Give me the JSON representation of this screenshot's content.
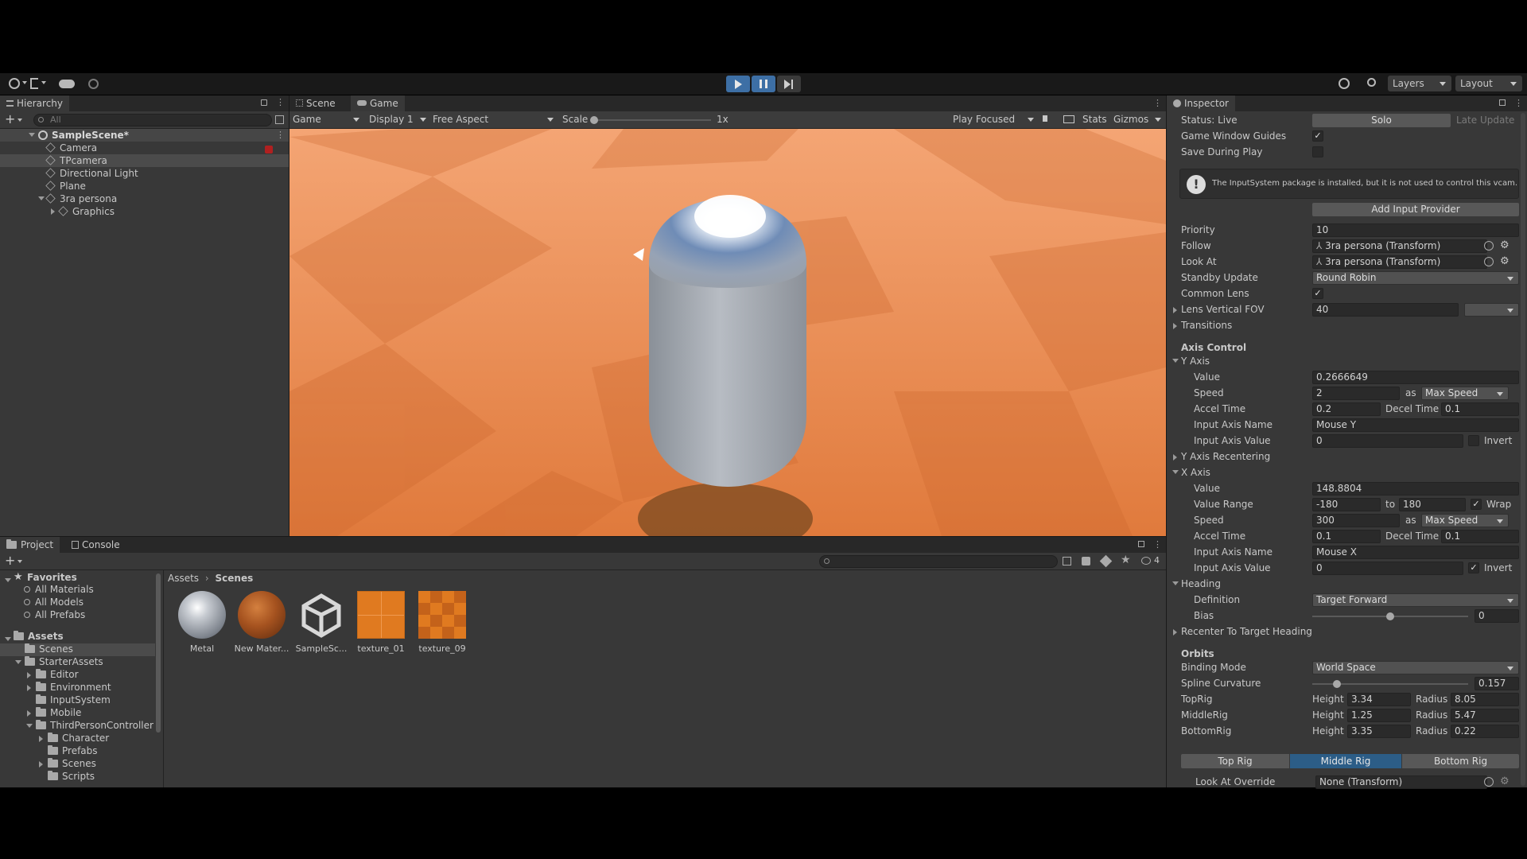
{
  "toolbar": {
    "layers": "Layers",
    "layout": "Layout"
  },
  "hierarchy": {
    "tab": "Hierarchy",
    "search_placeholder": "All",
    "scene": "SampleScene*",
    "items": [
      "Camera",
      "TPcamera",
      "Directional Light",
      "Plane",
      "3ra persona",
      "Graphics"
    ]
  },
  "viewport": {
    "tab_scene": "Scene",
    "tab_game": "Game",
    "game_dropdown": "Game",
    "display": "Display 1",
    "aspect": "Free Aspect",
    "scale_label": "Scale",
    "scale_value": "1x",
    "play_focused": "Play Focused",
    "stats": "Stats",
    "gizmos": "Gizmos"
  },
  "project": {
    "tab_project": "Project",
    "tab_console": "Console",
    "favorites": "Favorites",
    "fav_items": [
      "All Materials",
      "All Models",
      "All Prefabs"
    ],
    "assets": "Assets",
    "tree": [
      "Scenes",
      "StarterAssets",
      "Editor",
      "Environment",
      "InputSystem",
      "Mobile",
      "ThirdPersonController",
      "Character",
      "Prefabs",
      "Scenes",
      "Scripts"
    ],
    "breadcrumb": [
      "Assets",
      "Scenes"
    ],
    "hidden_count": "4",
    "asset_items": [
      "Metal",
      "New Mater...",
      "SampleSc...",
      "texture_01",
      "texture_09"
    ]
  },
  "inspector": {
    "tab": "Inspector",
    "status_label": "Status: Live",
    "solo": "Solo",
    "late_update": "Late Update",
    "game_window_guides": "Game Window Guides",
    "save_during_play": "Save During Play",
    "help_text": "The InputSystem package is installed, but it is not used to control this vcam.",
    "add_input_provider": "Add Input Provider",
    "priority": {
      "label": "Priority",
      "value": "10"
    },
    "follow": {
      "label": "Follow",
      "value": "3ra persona (Transform)"
    },
    "look_at": {
      "label": "Look At",
      "value": "3ra persona (Transform)"
    },
    "standby_update": {
      "label": "Standby Update",
      "value": "Round Robin"
    },
    "common_lens": "Common Lens",
    "lens_fov": {
      "label": "Lens Vertical FOV",
      "value": "40"
    },
    "transitions": "Transitions",
    "axis_control": "Axis Control",
    "y_axis": {
      "title": "Y Axis",
      "value_label": "Value",
      "value": "0.2666649",
      "speed_label": "Speed",
      "speed": "2",
      "as": "as",
      "speed_mode": "Max Speed",
      "accel_label": "Accel Time",
      "accel": "0.2",
      "decel_label": "Decel Time",
      "decel": "0.1",
      "input_name_label": "Input Axis Name",
      "input_name": "Mouse Y",
      "input_value_label": "Input Axis Value",
      "input_value": "0",
      "invert": "Invert"
    },
    "y_axis_recentering": "Y Axis Recentering",
    "x_axis": {
      "title": "X Axis",
      "value_label": "Value",
      "value": "148.8804",
      "range_label": "Value Range",
      "range_min": "-180",
      "to": "to",
      "range_max": "180",
      "wrap": "Wrap",
      "speed_label": "Speed",
      "speed": "300",
      "as": "as",
      "speed_mode": "Max Speed",
      "accel_label": "Accel Time",
      "accel": "0.1",
      "decel_label": "Decel Time",
      "decel": "0.1",
      "input_name_label": "Input Axis Name",
      "input_name": "Mouse X",
      "input_value_label": "Input Axis Value",
      "input_value": "0",
      "invert": "Invert"
    },
    "heading": {
      "title": "Heading",
      "definition_label": "Definition",
      "definition": "Target Forward",
      "bias_label": "Bias",
      "bias": "0",
      "bias_fraction": 0.5
    },
    "recenter": "Recenter To Target Heading",
    "orbits": {
      "title": "Orbits",
      "binding_label": "Binding Mode",
      "binding": "World Space",
      "spline_label": "Spline Curvature",
      "spline": "0.157",
      "spline_fraction": 0.157,
      "height": "Height",
      "radius": "Radius",
      "rigs": [
        {
          "name": "TopRig",
          "height": "3.34",
          "radius": "8.05"
        },
        {
          "name": "MiddleRig",
          "height": "1.25",
          "radius": "5.47"
        },
        {
          "name": "BottomRig",
          "height": "3.35",
          "radius": "0.22"
        }
      ]
    },
    "rig_tabs": [
      "Top Rig",
      "Middle Rig",
      "Bottom Rig"
    ],
    "look_at_override": {
      "label": "Look At Override",
      "value": "None (Transform)"
    }
  },
  "colors": {
    "panel": "#383838",
    "dark": "#282828",
    "selected_tab": "#2c5d87",
    "play_active": "#3d6fa5"
  }
}
